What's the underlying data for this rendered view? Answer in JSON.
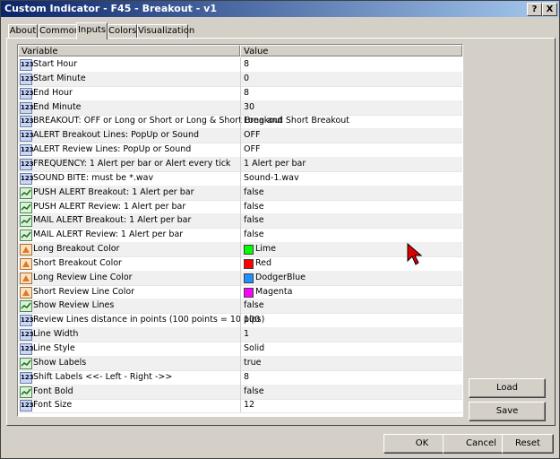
{
  "window": {
    "title": "Custom Indicator - F45 - Breakout - v1",
    "help_label": "?",
    "close_label": "X"
  },
  "tabs": [
    {
      "label": "About"
    },
    {
      "label": "Common"
    },
    {
      "label": "Inputs"
    },
    {
      "label": "Colors"
    },
    {
      "label": "Visualization"
    }
  ],
  "active_tab": "Inputs",
  "table": {
    "headers": {
      "variable": "Variable",
      "value": "Value"
    },
    "rows": [
      {
        "type": "int",
        "icon": "123",
        "variable": "Start Hour",
        "value": "8"
      },
      {
        "type": "int",
        "icon": "123",
        "variable": "Start Minute",
        "value": "0"
      },
      {
        "type": "int",
        "icon": "123",
        "variable": "End Hour",
        "value": "8"
      },
      {
        "type": "int",
        "icon": "123",
        "variable": "End Minute",
        "value": "30"
      },
      {
        "type": "int",
        "icon": "123",
        "variable": "BREAKOUT: OFF or Long or Short or Long & Short Breakout",
        "value": "Long and Short Breakout"
      },
      {
        "type": "int",
        "icon": "123",
        "variable": "ALERT Breakout Lines: PopUp or Sound",
        "value": "OFF"
      },
      {
        "type": "int",
        "icon": "123",
        "variable": "ALERT Review Lines: PopUp or Sound",
        "value": "OFF"
      },
      {
        "type": "int",
        "icon": "123",
        "variable": "FREQUENCY: 1 Alert per bar or Alert every tick",
        "value": "1 Alert per bar"
      },
      {
        "type": "int",
        "icon": "123",
        "variable": "SOUND BITE:  must be *.wav",
        "value": "Sound-1.wav"
      },
      {
        "type": "bool",
        "icon": "",
        "variable": "PUSH ALERT Breakout: 1 Alert per bar",
        "value": "false"
      },
      {
        "type": "bool",
        "icon": "",
        "variable": "PUSH ALERT Review: 1 Alert per bar",
        "value": "false"
      },
      {
        "type": "bool",
        "icon": "",
        "variable": "MAIL ALERT Breakout: 1 Alert per bar",
        "value": "false"
      },
      {
        "type": "bool",
        "icon": "",
        "variable": "MAIL ALERT Review: 1 Alert per bar",
        "value": "false"
      },
      {
        "type": "color",
        "icon": "",
        "variable": "Long Breakout Color",
        "value": "Lime",
        "swatch": "#00ff00"
      },
      {
        "type": "color",
        "icon": "",
        "variable": "Short Breakout Color",
        "value": "Red",
        "swatch": "#ff0000"
      },
      {
        "type": "color",
        "icon": "",
        "variable": "Long Review Line  Color",
        "value": "DodgerBlue",
        "swatch": "#1e90ff"
      },
      {
        "type": "color",
        "icon": "",
        "variable": "Short Review Line Color",
        "value": "Magenta",
        "swatch": "#ff00ff"
      },
      {
        "type": "bool",
        "icon": "",
        "variable": "Show Review Lines",
        "value": "false"
      },
      {
        "type": "int",
        "icon": "123",
        "variable": "Review Lines distance in points (100 points = 10 pips)",
        "value": "100"
      },
      {
        "type": "int",
        "icon": "123",
        "variable": "Line Width",
        "value": "1"
      },
      {
        "type": "int",
        "icon": "123",
        "variable": "Line Style",
        "value": "Solid"
      },
      {
        "type": "bool",
        "icon": "",
        "variable": "Show Labels",
        "value": "true"
      },
      {
        "type": "int",
        "icon": "123",
        "variable": "Shift Labels <<- Left - Right ->>",
        "value": "8"
      },
      {
        "type": "bool",
        "icon": "",
        "variable": "Font Bold",
        "value": "false"
      },
      {
        "type": "int",
        "icon": "123",
        "variable": "Font Size",
        "value": "12"
      }
    ]
  },
  "buttons": {
    "load": "Load",
    "save": "Save",
    "ok": "OK",
    "cancel": "Cancel",
    "reset": "Reset"
  },
  "colors": {
    "titlebar_start": "#0a246a",
    "titlebar_end": "#a6caf0",
    "dialog_bg": "#d4d0c8",
    "cursor": "#e00000"
  }
}
